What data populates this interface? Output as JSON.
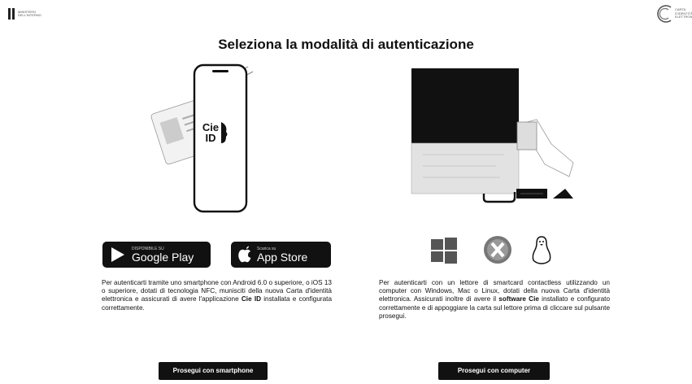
{
  "header": {
    "left_logo_text": "MINISTERO DELL'INTERNO",
    "right_logo_text": "CARTA D'IDENTITÀ ELETTRONICA"
  },
  "title": "Seleziona la modalità di autenticazione",
  "smartphone": {
    "phone_logo_line1": "Cie",
    "phone_logo_line2": "ID",
    "google_play": {
      "small": "DISPONIBILE SU",
      "big": "Google Play"
    },
    "app_store": {
      "small": "Scarica su",
      "big": "App Store"
    },
    "desc_before": "Per autenticarti tramite uno smartphone con Android 6.0 o superiore, o iOS 13 o superiore, dotati di tecnologia NFC, munisciti della nuova Carta d'identità elettronica e assicurati di avere l'applicazione ",
    "desc_bold": "Cie ID",
    "desc_after": " installata e configurata correttamente.",
    "button_label": "Prosegui con smartphone"
  },
  "computer": {
    "os_icons": [
      "windows-icon",
      "macos-icon",
      "linux-icon"
    ],
    "desc_before": "Per autenticarti con un lettore di smartcard contactless utilizzando un computer con Windows, Mac o Linux, dotati della nuova Carta d'identità elettronica. Assicurati inoltre di avere il ",
    "desc_bold": "software Cie",
    "desc_after": " installato e configurato correttamente e di appoggiare la carta sul lettore prima di cliccare sul pulsante prosegui.",
    "button_label": "Prosegui con computer"
  },
  "colors": {
    "button_bg": "#111111",
    "text": "#111111"
  }
}
